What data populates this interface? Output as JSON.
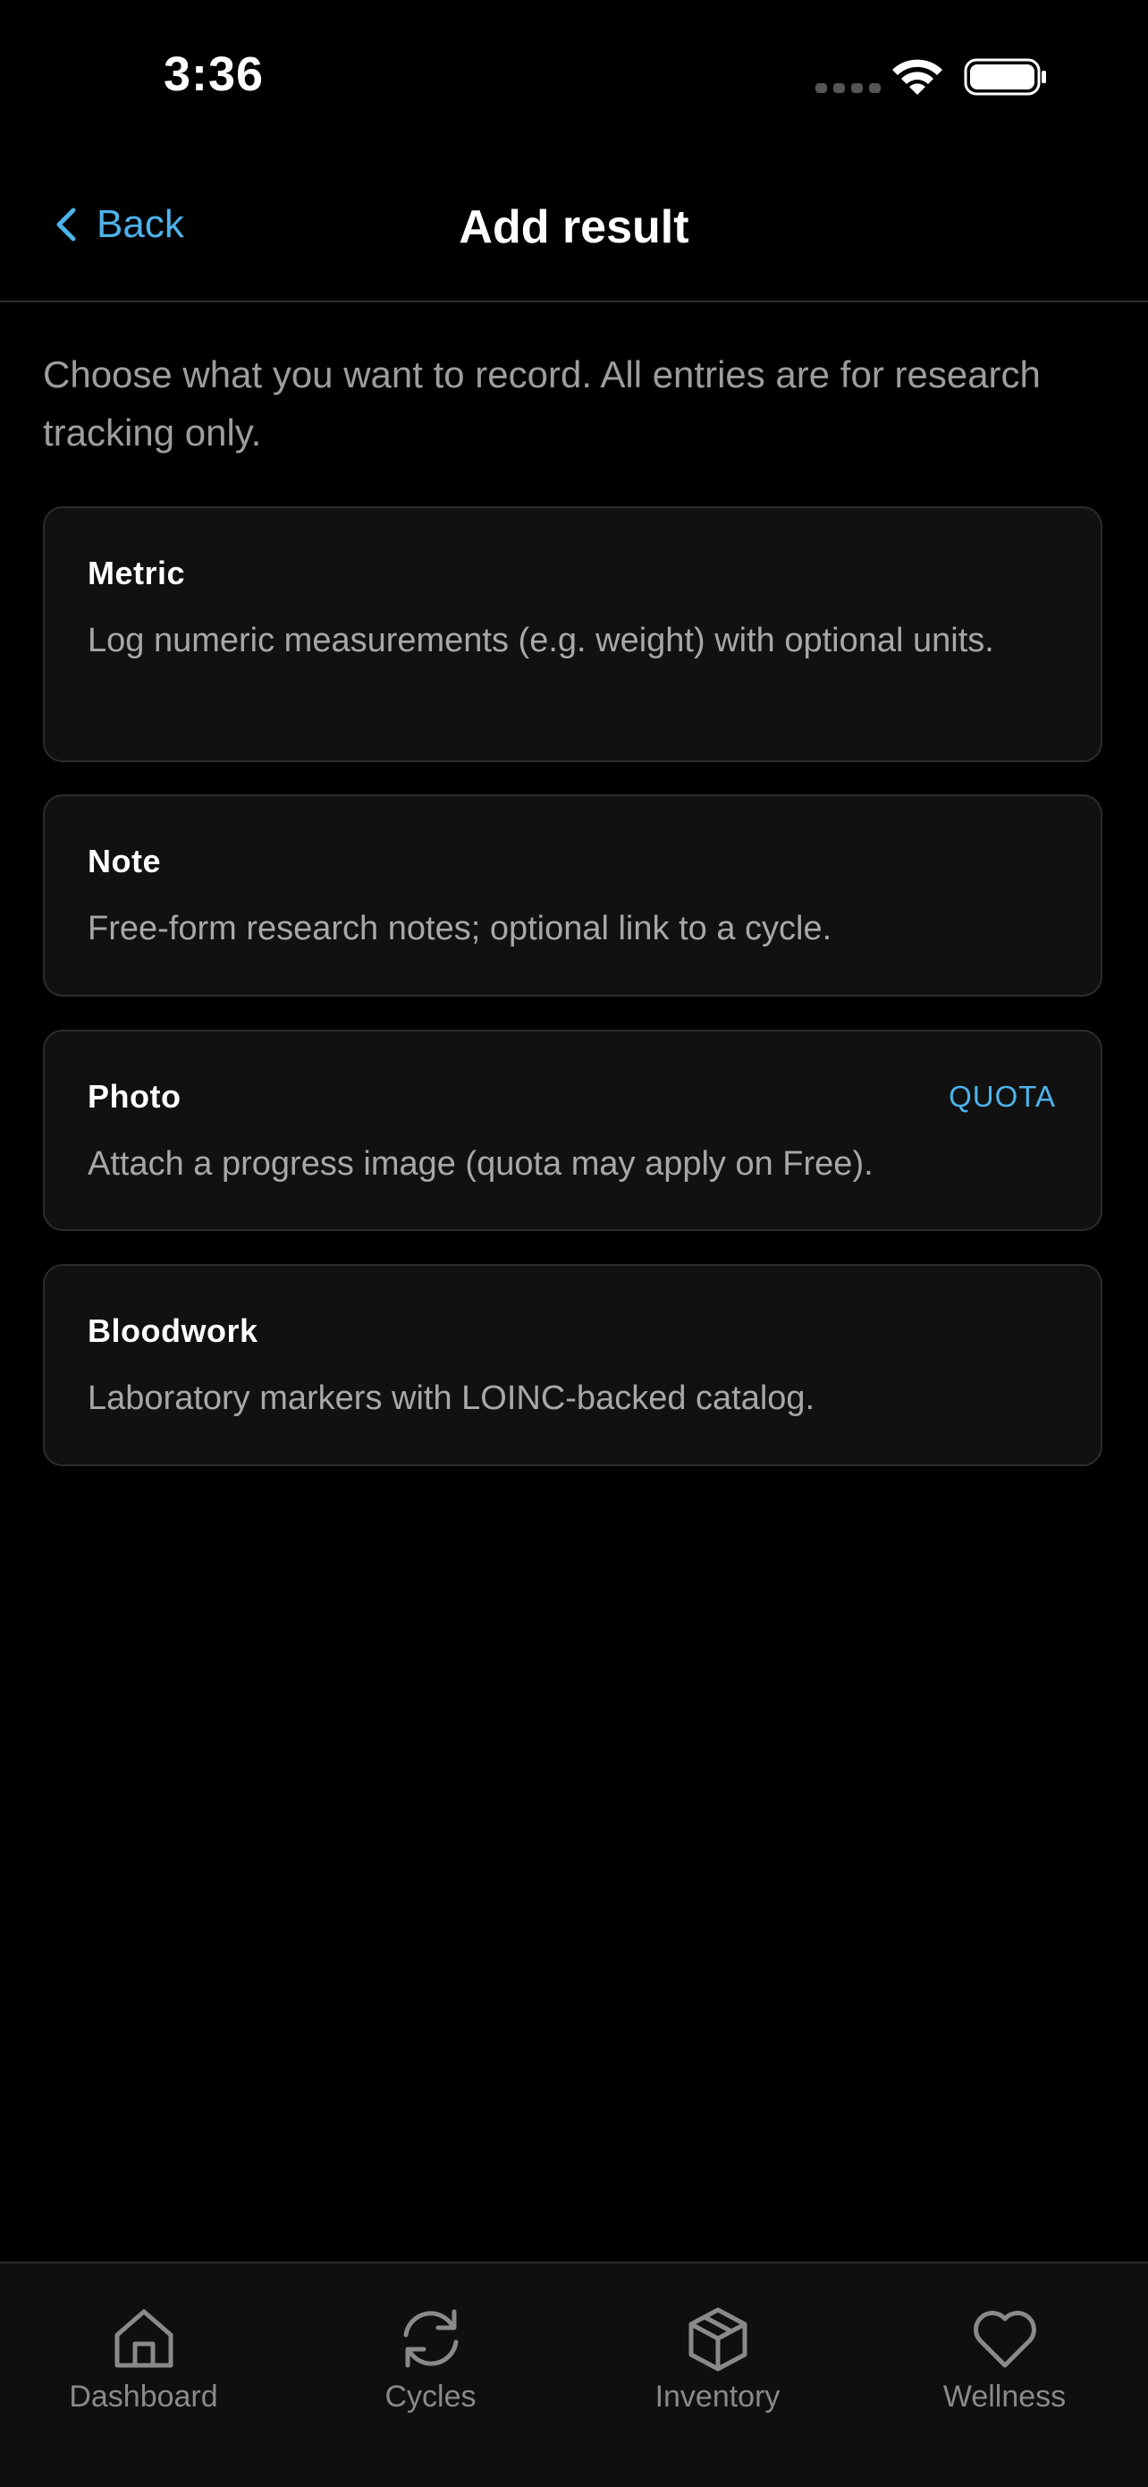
{
  "status_bar": {
    "time": "3:36"
  },
  "nav": {
    "back_label": "Back",
    "title": "Add result"
  },
  "intro": "Choose what you want to record. All entries are for research tracking only.",
  "options": [
    {
      "title": "Metric",
      "description": "Log numeric measurements (e.g. weight) with optional units.",
      "badge": ""
    },
    {
      "title": "Note",
      "description": "Free-form research notes; optional link to a cycle.",
      "badge": ""
    },
    {
      "title": "Photo",
      "description": "Attach a progress image (quota may apply on Free).",
      "badge": "QUOTA"
    },
    {
      "title": "Bloodwork",
      "description": "Laboratory markers with LOINC-backed catalog.",
      "badge": ""
    }
  ],
  "tabs": [
    {
      "label": "Dashboard",
      "icon": "home-icon"
    },
    {
      "label": "Cycles",
      "icon": "refresh-icon"
    },
    {
      "label": "Inventory",
      "icon": "box-icon"
    },
    {
      "label": "Wellness",
      "icon": "heart-icon"
    }
  ],
  "colors": {
    "accent": "#4db3ea",
    "background": "#000000",
    "card": "#111111",
    "muted_text": "#a8a8a8"
  }
}
